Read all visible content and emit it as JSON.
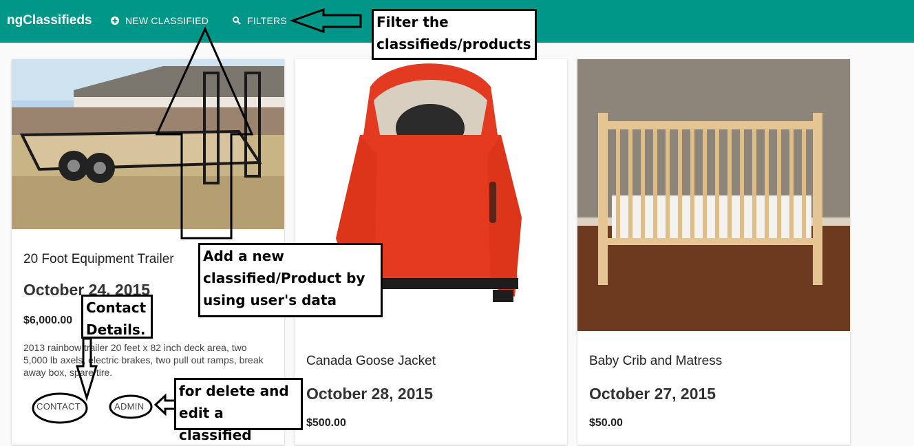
{
  "toolbar": {
    "brand": "ngClassifieds",
    "new_classified_label": "NEW CLASSIFIED",
    "filters_label": "FILTERS",
    "bg_color": "#009688"
  },
  "cards": [
    {
      "title": "20 Foot Equipment Trailer",
      "date": "October 24, 2015",
      "price": "$6,000.00",
      "description": "2013 rainbow trailer 20 feet x 82 inch deck area, two 5,000 lb axels, electric brakes, two pull out ramps, break away box, spare tire.",
      "contact_label": "CONTACT",
      "admin_label": "ADMIN"
    },
    {
      "title": "Canada Goose Jacket",
      "date": "October 28, 2015",
      "price": "$500.00"
    },
    {
      "title": "Baby Crib and Matress",
      "date": "October 27, 2015",
      "price": "$50.00"
    }
  ],
  "annotations": {
    "filter": "Filter the classifieds/products",
    "add": "Add a new classified/Product by using user's data",
    "contact": "Contact Details.",
    "admin": "for delete and edit a classified"
  }
}
